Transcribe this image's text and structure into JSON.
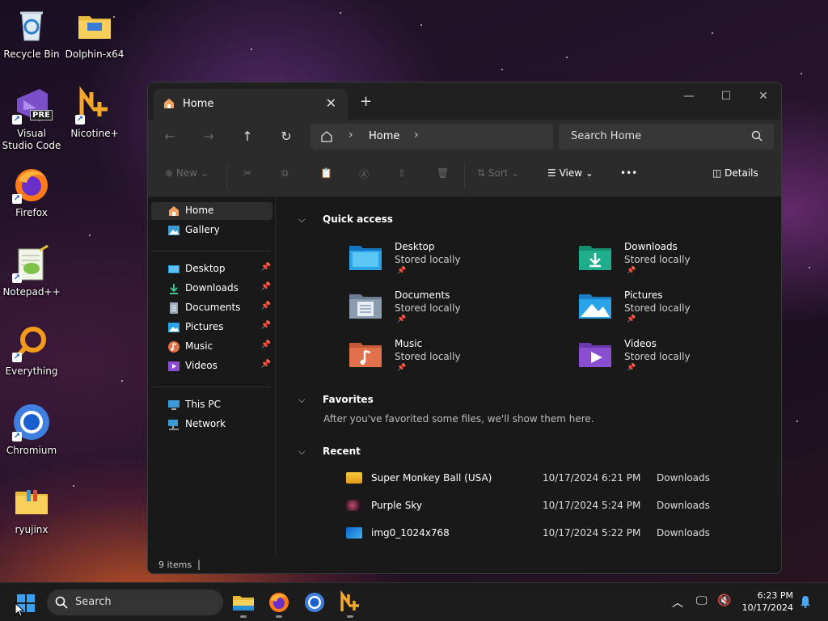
{
  "desktop": {
    "icons": [
      {
        "label": "Recycle Bin",
        "icon": "recycle-bin-icon"
      },
      {
        "label": "Dolphin-x64",
        "icon": "folder-icon"
      },
      {
        "label": "Visual Studio Code",
        "icon": "visual-studio-icon",
        "badge": "PRE"
      },
      {
        "label": "Nicotine+",
        "icon": "nicotine-icon"
      },
      {
        "label": "Firefox",
        "icon": "firefox-icon"
      },
      {
        "label": "Notepad++",
        "icon": "notepad-plus-plus-icon"
      },
      {
        "label": "Everything",
        "icon": "everything-search-icon"
      },
      {
        "label": "Chromium",
        "icon": "chromium-icon"
      },
      {
        "label": "ryujinx",
        "icon": "folder-icon"
      }
    ]
  },
  "window": {
    "tab_title": "Home",
    "nav": {
      "breadcrumb": "Home",
      "search_placeholder": "Search Home"
    },
    "toolbar": {
      "new_label": "New",
      "sort_label": "Sort",
      "view_label": "View",
      "more_label": "•••",
      "details_label": "Details"
    },
    "sidebar": {
      "top": [
        {
          "label": "Home",
          "icon": "home-icon"
        },
        {
          "label": "Gallery",
          "icon": "gallery-icon"
        }
      ],
      "pinned": [
        {
          "label": "Desktop",
          "icon": "desktop-folder-icon"
        },
        {
          "label": "Downloads",
          "icon": "download-icon"
        },
        {
          "label": "Documents",
          "icon": "documents-icon"
        },
        {
          "label": "Pictures",
          "icon": "pictures-icon"
        },
        {
          "label": "Music",
          "icon": "music-icon"
        },
        {
          "label": "Videos",
          "icon": "videos-icon"
        }
      ],
      "bottom": [
        {
          "label": "This PC",
          "icon": "this-pc-icon"
        },
        {
          "label": "Network",
          "icon": "network-icon"
        }
      ]
    },
    "quick_access": {
      "title": "Quick access",
      "items": [
        {
          "name": "Desktop",
          "status": "Stored locally",
          "color": "#1e90d8"
        },
        {
          "name": "Downloads",
          "status": "Stored locally",
          "color": "#1fae8c"
        },
        {
          "name": "Documents",
          "status": "Stored locally",
          "color": "#8b9bb0"
        },
        {
          "name": "Pictures",
          "status": "Stored locally",
          "color": "#2aa3e8"
        },
        {
          "name": "Music",
          "status": "Stored locally",
          "color": "#e0714a"
        },
        {
          "name": "Videos",
          "status": "Stored locally",
          "color": "#8a4fd0"
        }
      ]
    },
    "favorites": {
      "title": "Favorites",
      "message": "After you've favorited some files, we'll show them here."
    },
    "recent": {
      "title": "Recent",
      "items": [
        {
          "name": "Super Monkey Ball (USA)",
          "date": "10/17/2024 6:21 PM",
          "location": "Downloads"
        },
        {
          "name": "Purple Sky",
          "date": "10/17/2024 5:24 PM",
          "location": "Downloads"
        },
        {
          "name": "img0_1024x768",
          "date": "10/17/2024 5:22 PM",
          "location": "Downloads"
        }
      ]
    },
    "status": {
      "item_count": "9 items"
    }
  },
  "taskbar": {
    "search_label": "Search",
    "time": "6:23 PM",
    "date": "10/17/2024"
  }
}
